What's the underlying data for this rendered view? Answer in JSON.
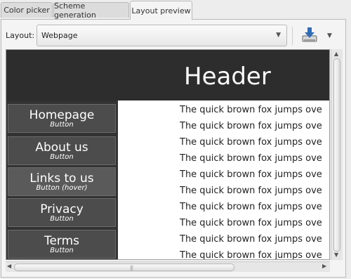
{
  "tabs": [
    {
      "label": "Color picker"
    },
    {
      "label": "Scheme generation"
    },
    {
      "label": "Layout preview"
    }
  ],
  "toolbar": {
    "layout_label": "Layout:",
    "layout_value": "Webpage",
    "dropdown_icon": "chevron-down-icon",
    "save_icon": "download-icon"
  },
  "preview": {
    "header": "Header",
    "nav": [
      {
        "label": "Homepage",
        "sub": "Button"
      },
      {
        "label": "About us",
        "sub": "Button"
      },
      {
        "label": "Links to us",
        "sub": "Button (hover)"
      },
      {
        "label": "Privacy",
        "sub": "Button"
      },
      {
        "label": "Terms",
        "sub": "Button"
      }
    ],
    "body_lines": [
      "The quick brown fox jumps ove",
      "The quick brown fox jumps ove",
      "The quick brown fox jumps ove",
      "The quick brown fox jumps ove",
      "The quick brown fox jumps ove",
      "The quick brown fox jumps ove",
      "The quick brown fox jumps ove",
      "The quick brown fox jumps ove",
      "The quick brown fox jumps ove",
      "The quick brown fox jumps ove"
    ]
  },
  "colors": {
    "header_bg": "#2d2d2d",
    "button_bg": "#4c4c4c",
    "content_bg": "#ffffff"
  }
}
